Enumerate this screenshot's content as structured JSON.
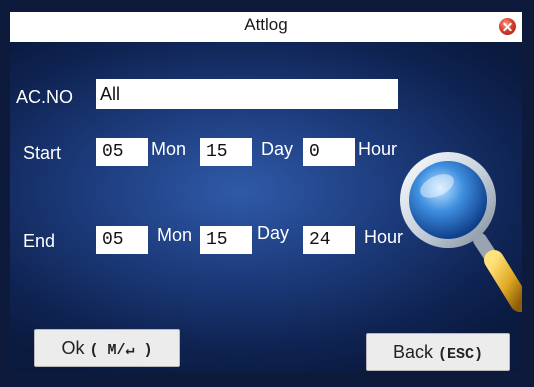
{
  "window": {
    "title": "Attlog"
  },
  "form": {
    "acno": {
      "label": "AC.NO",
      "value": "All"
    },
    "start": {
      "label": "Start",
      "month": "05",
      "mon_label": "Mon",
      "day": "15",
      "day_label": "Day",
      "hour": "0",
      "hour_label": "Hour"
    },
    "end": {
      "label": "End",
      "month": "05",
      "mon_label": "Mon",
      "day": "15",
      "day_label": "Day",
      "hour": "24",
      "hour_label": "Hour"
    }
  },
  "buttons": {
    "ok": {
      "label": "Ok",
      "key": "( M/↵ )"
    },
    "back": {
      "label": "Back",
      "key": "(ESC)"
    }
  },
  "icons": {
    "close": "close-icon",
    "search": "magnifier-icon"
  },
  "colors": {
    "background": "#0d1a3c",
    "panel": "#1c3a7a",
    "field": "#ffffff",
    "close": "#d8412d"
  }
}
